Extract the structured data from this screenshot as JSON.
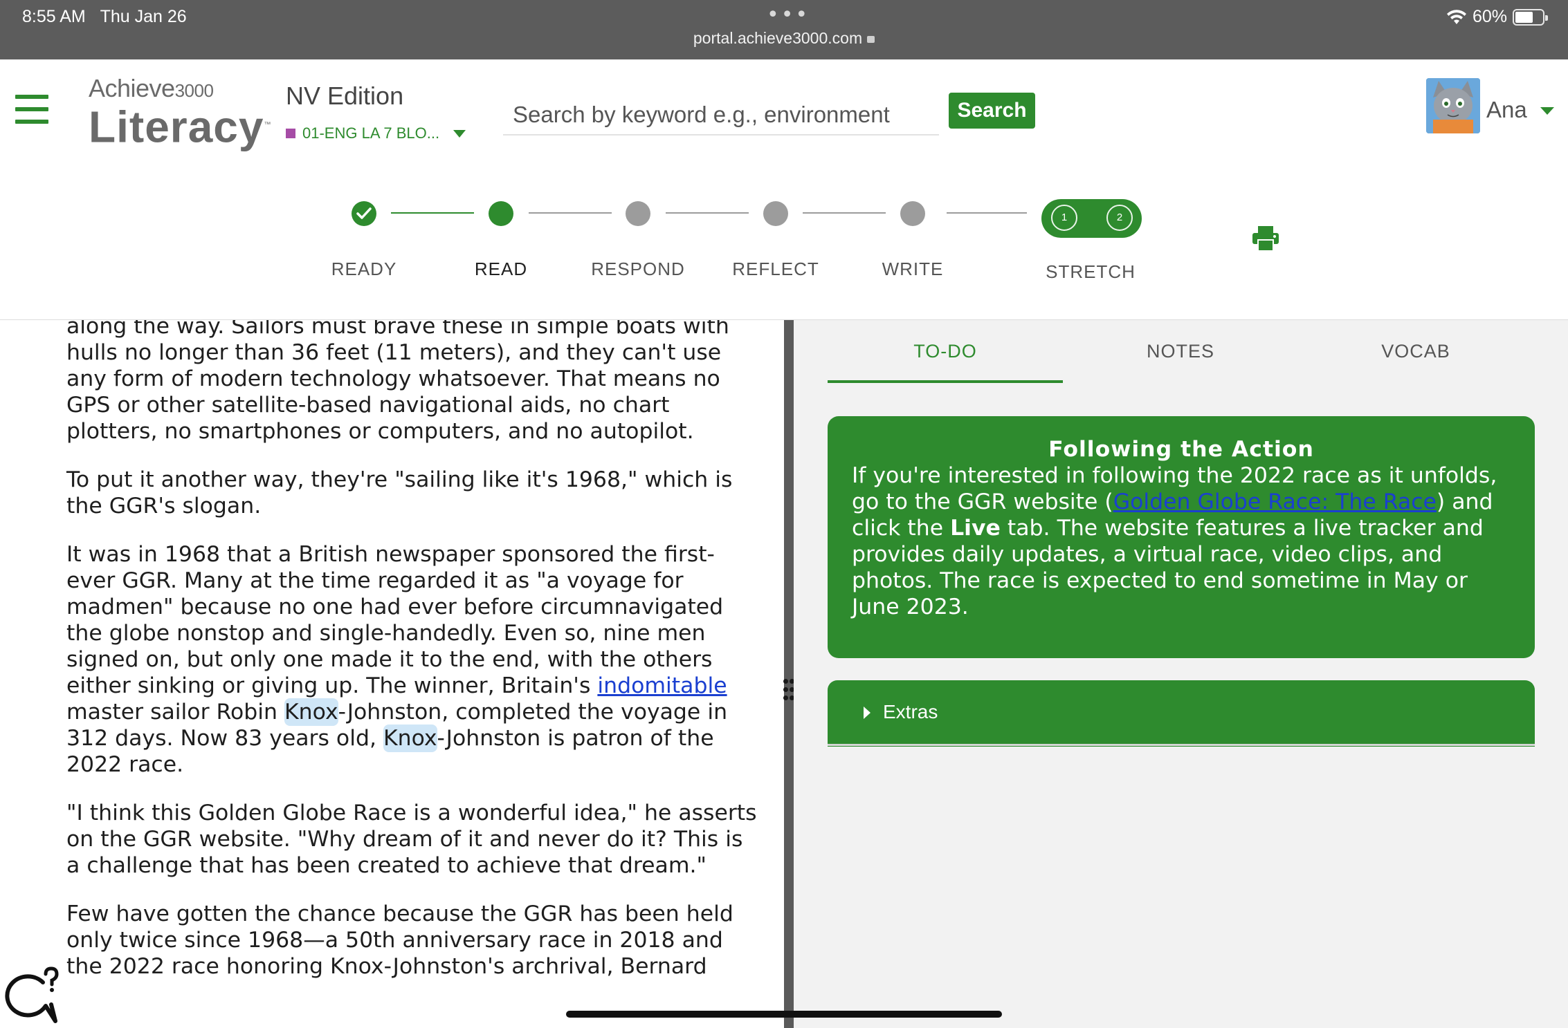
{
  "status_bar": {
    "time": "8:55 AM",
    "date": "Thu Jan 26",
    "url": "portal.achieve3000.com",
    "battery": "60%"
  },
  "header": {
    "logo_top": "Achieve",
    "logo_top_small": "3000",
    "logo_bottom": "Literacy",
    "edition": "NV Edition",
    "class_name": "01-ENG LA 7 BLO...",
    "search_placeholder": "Search by keyword e.g., environment",
    "search_button": "Search",
    "user_name": "Ana"
  },
  "stepper": {
    "steps": [
      {
        "label": "READY",
        "state": "done"
      },
      {
        "label": "READ",
        "state": "active"
      },
      {
        "label": "RESPOND",
        "state": "pending"
      },
      {
        "label": "REFLECT",
        "state": "pending"
      },
      {
        "label": "WRITE",
        "state": "pending"
      },
      {
        "label": "STRETCH",
        "state": "pending"
      }
    ],
    "stretch_items": [
      "1",
      "2"
    ]
  },
  "article": {
    "p1": "along the way. Sailors must brave these in simple boats with hulls no longer than 36 feet (11 meters), and they can't use any form of modern technology whatsoever. That means no GPS or other satellite-based navigational aids, no chart plotters, no smartphones or computers, and no autopilot.",
    "p2": "To put it another way, they're \"sailing like it's 1968,\" which is the GGR's slogan.",
    "p3_a": "It was in 1968 that a British newspaper sponsored the first-ever GGR. Many at the time regarded it as \"a voyage for madmen\" because no one had ever before circumnavigated the globe nonstop and single-handedly. Even so, nine men signed on, but only one made it to the end, with the others either sinking or giving up. The winner, Britain's ",
    "p3_link": "indomitable",
    "p3_b": " master sailor Robin ",
    "p3_hl1": "Knox",
    "p3_c": "-Johnston, completed the voyage in 312 days. Now 83 years old, ",
    "p3_hl2": "Knox",
    "p3_d": "-Johnston is patron of the 2022 race.",
    "p4": "\"I think this Golden Globe Race is a wonderful idea,\" he asserts on the GGR website. \"Why dream of it and never do it? This is a challenge that has been created to achieve that dream.\"",
    "p5": "Few have gotten the chance because the GGR has been held only twice since 1968—a 50th anniversary race in 2018 and the 2022 race honoring Knox-Johnston's archrival, Bernard"
  },
  "side_panel": {
    "tabs": [
      "TO-DO",
      "NOTES",
      "VOCAB"
    ],
    "active_tab": "TO-DO",
    "card": {
      "title": "Following the Action",
      "body_a": "If you're interested in following the 2022 race as it unfolds, go to the GGR website (",
      "body_link": "Golden Globe Race: The Race",
      "body_b": ") and click the ",
      "body_bold": "Live",
      "body_c": " tab. The website features a live tracker and provides daily updates, a virtual race, video clips, and photos. The race is expected to end sometime in May or June 2023."
    },
    "extras_label": "Extras"
  },
  "colors": {
    "brand_green": "#2e8b2e",
    "link_blue": "#1a3fd0",
    "highlight": "#cfe6f7",
    "pending_grey": "#9c9c9c"
  }
}
